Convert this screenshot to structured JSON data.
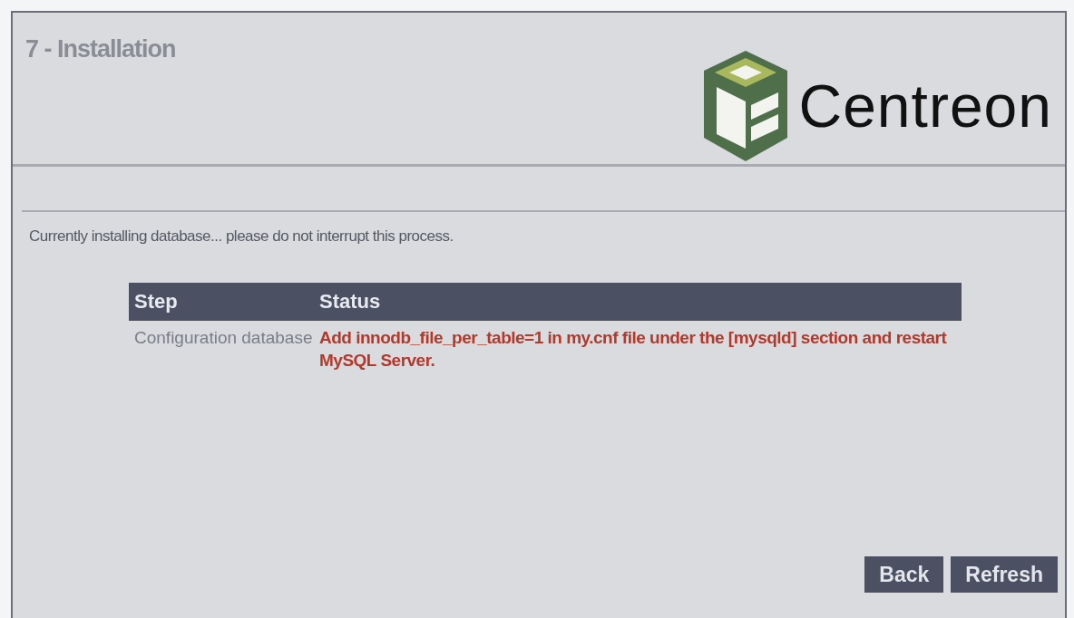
{
  "header": {
    "title": "7 - Installation",
    "logo_text": "Centreon"
  },
  "message": "Currently installing database... please do not interrupt this process.",
  "table": {
    "columns": [
      "Step",
      "Status"
    ],
    "rows": [
      {
        "step": "Configuration database",
        "status": "Add innodb_file_per_table=1 in my.cnf file under the [mysqld] section and restart MySQL Server.",
        "kind": "error"
      }
    ]
  },
  "buttons": [
    "Back",
    "Refresh"
  ]
}
